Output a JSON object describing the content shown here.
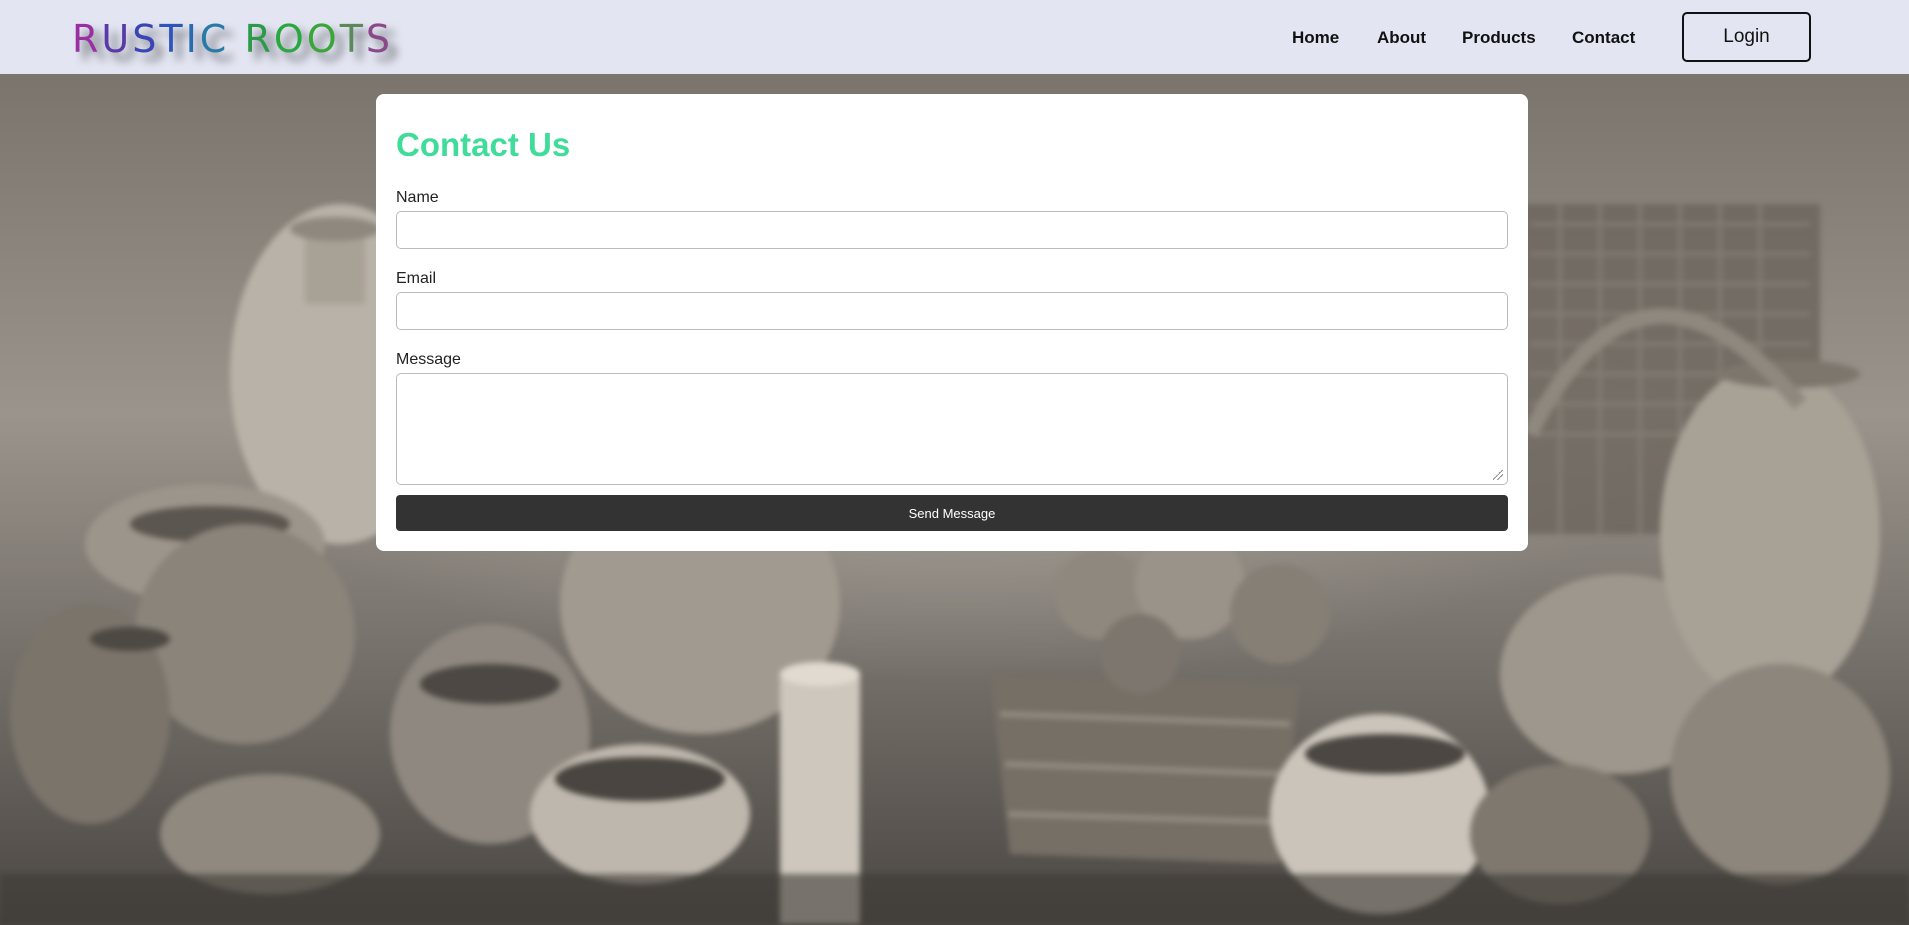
{
  "header": {
    "logo_letters": [
      {
        "ch": "R",
        "color": "#9a2fa3"
      },
      {
        "ch": "U",
        "color": "#5a3aa8"
      },
      {
        "ch": "S",
        "color": "#3a45b5"
      },
      {
        "ch": "T",
        "color": "#2d55b8"
      },
      {
        "ch": "I",
        "color": "#2a6ab0"
      },
      {
        "ch": "C",
        "color": "#2a7aa6"
      },
      {
        "ch": " ",
        "color": "#000000"
      },
      {
        "ch": "R",
        "color": "#2c9a4a"
      },
      {
        "ch": "O",
        "color": "#2aa840"
      },
      {
        "ch": "O",
        "color": "#3aa63a"
      },
      {
        "ch": "T",
        "color": "#5a8a5a"
      },
      {
        "ch": "S",
        "color": "#8a4a8a"
      }
    ],
    "nav": {
      "home": "Home",
      "about": "About",
      "products": "Products",
      "contact": "Contact"
    },
    "login_label": "Login"
  },
  "contact": {
    "title": "Contact Us",
    "title_color": "#3fdc9a",
    "name_label": "Name",
    "name_value": "",
    "email_label": "Email",
    "email_value": "",
    "message_label": "Message",
    "message_value": "",
    "submit_label": "Send Message"
  },
  "colors": {
    "header_bg": "#e3e6f2",
    "button_bg": "#333333"
  }
}
